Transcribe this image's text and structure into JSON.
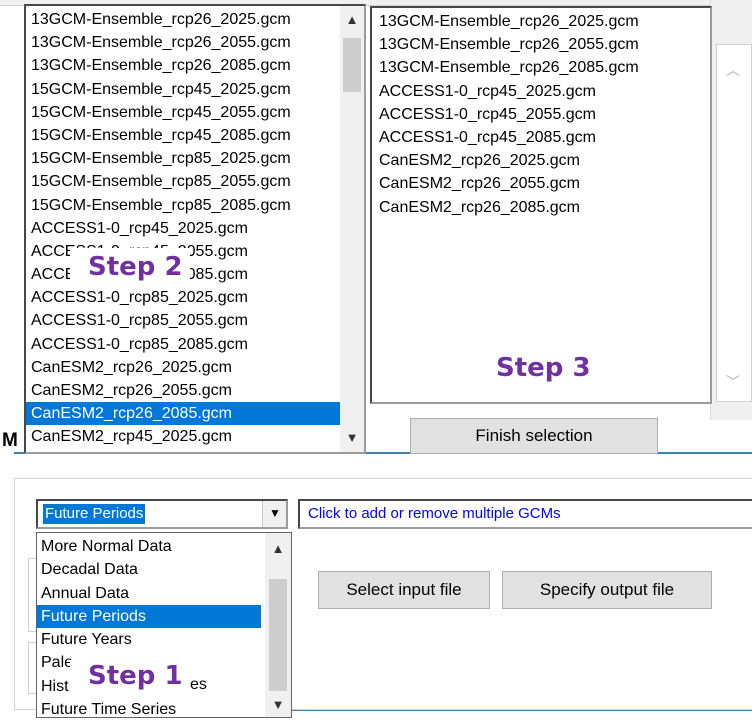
{
  "left_list": {
    "items": [
      "13GCM-Ensemble_rcp26_2025.gcm",
      "13GCM-Ensemble_rcp26_2055.gcm",
      "13GCM-Ensemble_rcp26_2085.gcm",
      "15GCM-Ensemble_rcp45_2025.gcm",
      "15GCM-Ensemble_rcp45_2055.gcm",
      "15GCM-Ensemble_rcp45_2085.gcm",
      "15GCM-Ensemble_rcp85_2025.gcm",
      "15GCM-Ensemble_rcp85_2055.gcm",
      "15GCM-Ensemble_rcp85_2085.gcm",
      "ACCESS1-0_rcp45_2025.gcm",
      "ACCESS1-0_rcp45_2055.gcm",
      "ACCESS1-0_rcp45_2085.gcm",
      "ACCESS1-0_rcp85_2025.gcm",
      "ACCESS1-0_rcp85_2055.gcm",
      "ACCESS1-0_rcp85_2085.gcm",
      "CanESM2_rcp26_2025.gcm",
      "CanESM2_rcp26_2055.gcm",
      "CanESM2_rcp26_2085.gcm",
      "CanESM2_rcp45_2025.gcm"
    ],
    "selected_index": 17
  },
  "right_list": {
    "items": [
      "13GCM-Ensemble_rcp26_2025.gcm",
      "13GCM-Ensemble_rcp26_2055.gcm",
      "13GCM-Ensemble_rcp26_2085.gcm",
      "ACCESS1-0_rcp45_2025.gcm",
      "ACCESS1-0_rcp45_2055.gcm",
      "ACCESS1-0_rcp45_2085.gcm",
      "CanESM2_rcp26_2025.gcm",
      "CanESM2_rcp26_2055.gcm",
      "CanESM2_rcp26_2085.gcm"
    ]
  },
  "finish_button": {
    "label": "Finish selection"
  },
  "hidden_letter": "M",
  "period_combo": {
    "value": "Future Periods"
  },
  "gcm_hint": "Click to add or remove multiple GCMs",
  "dropdown": {
    "options": [
      "More Normal Data",
      "Decadal Data",
      "Annual Data",
      "Future Periods",
      "Future Years",
      "Pale",
      "Hist",
      "Future Time Series"
    ],
    "selected_index": 3,
    "partial_suffix": "es"
  },
  "select_input_button": {
    "label": "Select input file"
  },
  "specify_output_button": {
    "label": "Specify output file"
  },
  "steps": {
    "step1": "Step 1",
    "step2": "Step 2",
    "step3": "Step 3"
  },
  "icons": {
    "scroll_up": "▲",
    "scroll_down": "▼",
    "chevron_up": "︿",
    "chevron_down": "﹀"
  },
  "colors": {
    "selection": "#0078d7",
    "step_text": "#7030a0",
    "hint_text": "#0000ff",
    "separator": "#3c7fb1"
  }
}
